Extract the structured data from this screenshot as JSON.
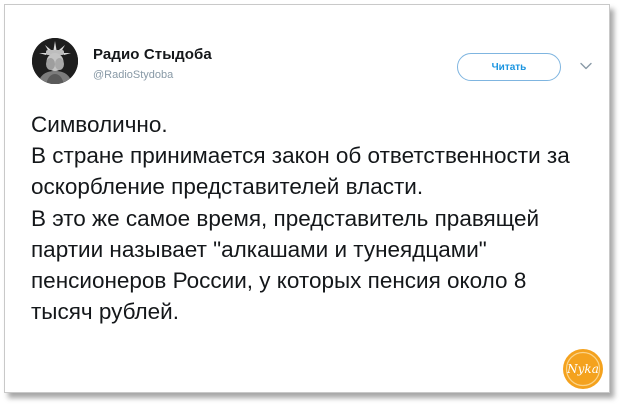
{
  "tweet": {
    "display_name": "Радио Стыдоба",
    "handle": "@RadioStydoba",
    "follow_label": "Читать",
    "text": "Символично.\nВ стране принимается закон об ответственности за оскорбление представителей власти.\nВ это же самое время, представитель правящей партии называет \"алкашами и тунеядцами\" пенсионеров России, у которых пенсия около 8 тысяч рублей."
  },
  "icons": {
    "avatar": "statue-of-liberty-avatar",
    "menu": "chevron-down-icon",
    "watermark": "nyka-logo"
  },
  "watermark": {
    "text": "Nyka"
  },
  "colors": {
    "accent": "#1b95e0",
    "text": "#14171a",
    "muted": "#8899a6",
    "watermark": "#f4a21e"
  }
}
